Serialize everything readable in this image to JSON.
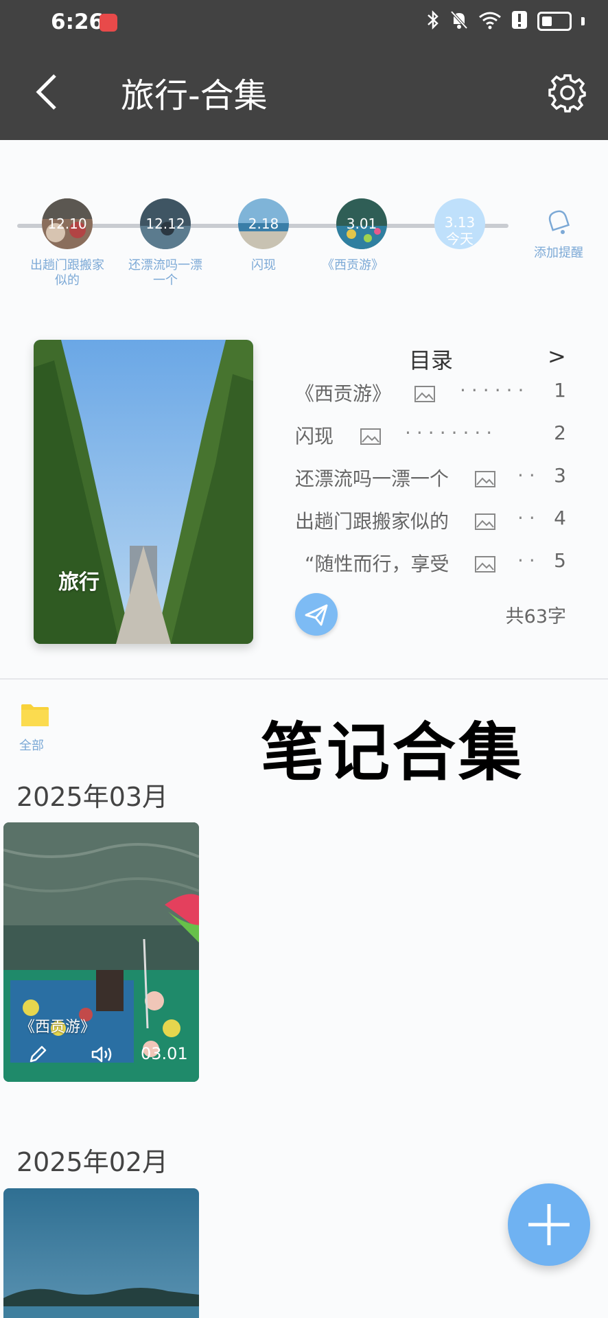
{
  "status_bar": {
    "time": "6:26"
  },
  "header": {
    "title": "旅行-合集",
    "back_icon": "back-arrow-icon",
    "settings_icon": "gear-icon"
  },
  "timeline": {
    "nodes": [
      {
        "date": "12.10",
        "label": "出趟门跟搬家似的"
      },
      {
        "date": "12.12",
        "label": "还漂流吗一漂一个"
      },
      {
        "date": "2.18",
        "label": "闪现"
      },
      {
        "date": "3.01",
        "label": "《西贡游》"
      },
      {
        "date": "3.13",
        "sub": "今天"
      }
    ],
    "reminder_label": "添加提醒"
  },
  "book": {
    "cover_title": "旅行",
    "toc_title": "目录",
    "toc_arrow": ">",
    "toc_items": [
      {
        "title": "《西贡游》",
        "page": "1"
      },
      {
        "title": "闪现",
        "page": "2"
      },
      {
        "title": "还漂流吗一漂一个",
        "page": "3"
      },
      {
        "title": "出趟门跟搬家似的",
        "page": "4"
      },
      {
        "title": "“随性而行，享受",
        "page": "5"
      }
    ],
    "word_count": "共63字"
  },
  "folder": {
    "label": "全部"
  },
  "overlay_title": "笔记合集",
  "months": [
    {
      "label": "2025年03月",
      "notes": [
        {
          "title": "《西贡游》",
          "date": "03.01"
        }
      ]
    },
    {
      "label": "2025年02月"
    }
  ],
  "colors": {
    "header_bg": "#424242",
    "accent": "#7dbbf4",
    "label_blue": "#7ca9d6",
    "fab": "#6fb2f2"
  }
}
